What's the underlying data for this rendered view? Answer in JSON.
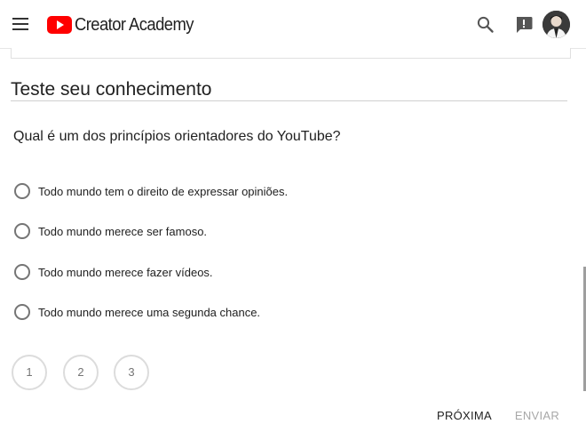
{
  "header": {
    "brand_text": "Creator Academy",
    "brand_color": "#ff0000",
    "menu_icon": "hamburger-menu-icon",
    "search_icon": "search-icon",
    "feedback_icon": "feedback-icon",
    "avatar_icon": "user-avatar"
  },
  "quiz": {
    "section_title": "Teste seu conhecimento",
    "question": "Qual é um dos princípios orientadores do YouTube?",
    "options": [
      {
        "label": "Todo mundo tem o direito de expressar opiniões."
      },
      {
        "label": "Todo mundo merece ser famoso."
      },
      {
        "label": "Todo mundo merece fazer vídeos."
      },
      {
        "label": "Todo mundo merece uma segunda chance."
      }
    ],
    "pages": [
      "1",
      "2",
      "3"
    ]
  },
  "actions": {
    "next_label": "PRÓXIMA",
    "send_label": "ENVIAR"
  }
}
